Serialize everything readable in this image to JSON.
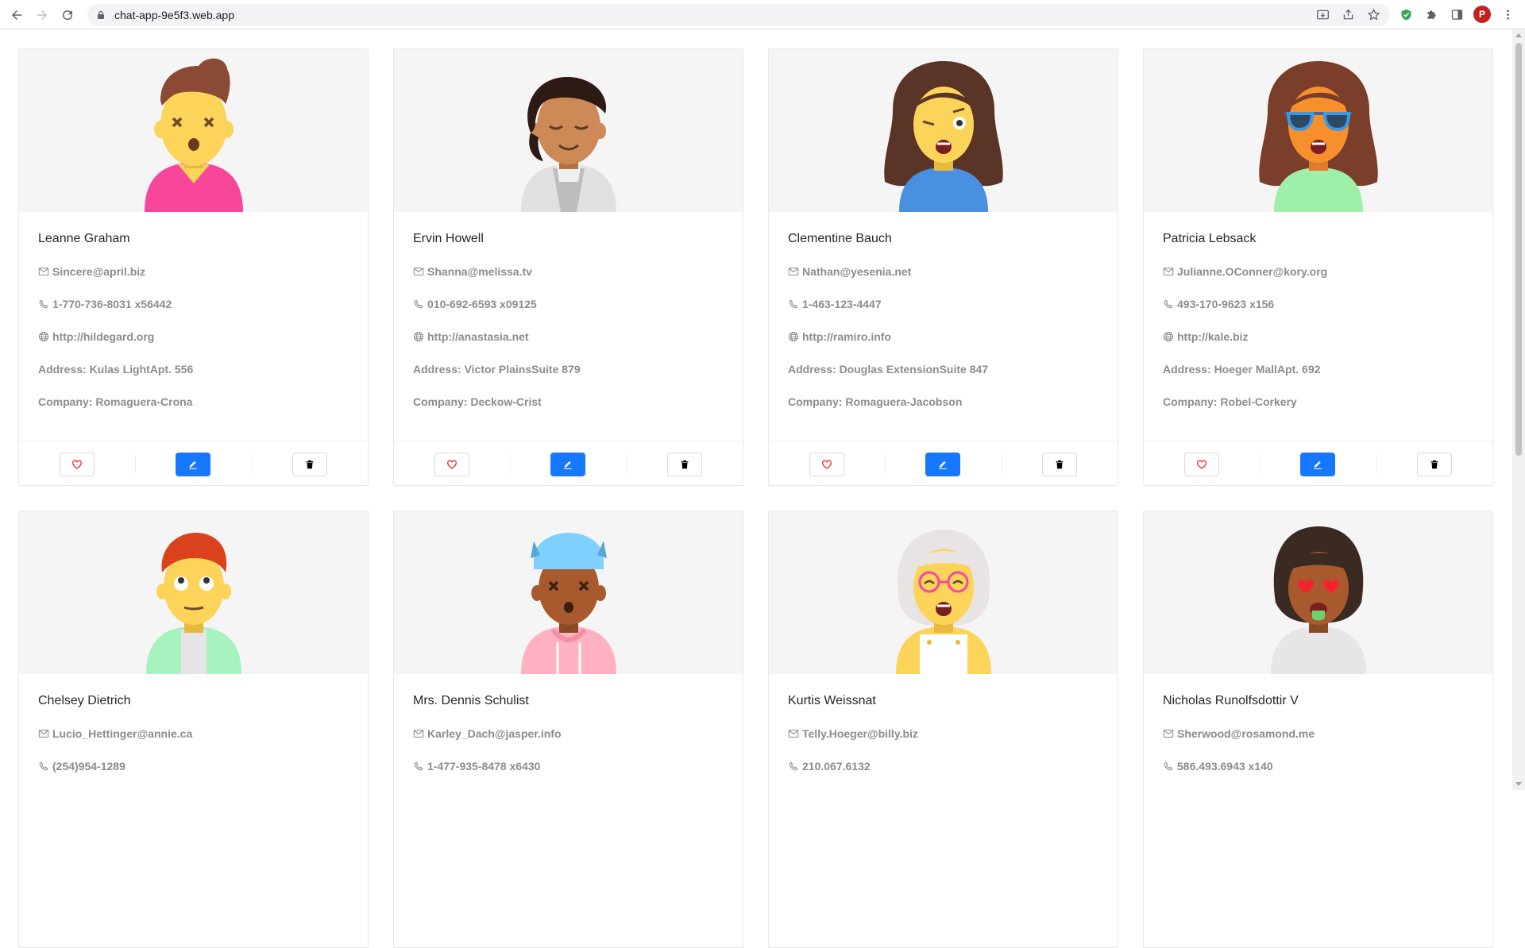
{
  "browser": {
    "url": "chat-app-9e5f3.web.app",
    "profile_initial": "P",
    "icons": [
      "back-icon",
      "forward-icon",
      "reload-icon",
      "lock-icon",
      "install-icon",
      "share-icon",
      "star-icon",
      "shield-extension-icon",
      "puzzle-extension-icon",
      "side-panel-icon",
      "kebab-menu-icon"
    ]
  },
  "colors": {
    "primary": "#1677ff",
    "heart": "#f5222d",
    "cover_bg": "#f5f5f5",
    "muted_text": "#8c8c8c"
  },
  "users": [
    {
      "name": "Leanne Graham",
      "email": "Sincere@april.biz",
      "phone": "1-770-736-8031 x56442",
      "website": "http://hildegard.org",
      "address": "Address: Kulas LightApt. 556",
      "company": "Company: Romaguera-Crona"
    },
    {
      "name": "Ervin Howell",
      "email": "Shanna@melissa.tv",
      "phone": "010-692-6593 x09125",
      "website": "http://anastasia.net",
      "address": "Address: Victor PlainsSuite 879",
      "company": "Company: Deckow-Crist"
    },
    {
      "name": "Clementine Bauch",
      "email": "Nathan@yesenia.net",
      "phone": "1-463-123-4447",
      "website": "http://ramiro.info",
      "address": "Address: Douglas ExtensionSuite 847",
      "company": "Company: Romaguera-Jacobson"
    },
    {
      "name": "Patricia Lebsack",
      "email": "Julianne.OConner@kory.org",
      "phone": "493-170-9623 x156",
      "website": "http://kale.biz",
      "address": "Address: Hoeger MallApt. 692",
      "company": "Company: Robel-Corkery"
    },
    {
      "name": "Chelsey Dietrich",
      "email": "Lucio_Hettinger@annie.ca",
      "phone": "(254)954-1289"
    },
    {
      "name": "Mrs. Dennis Schulist",
      "email": "Karley_Dach@jasper.info",
      "phone": "1-477-935-8478 x6430"
    },
    {
      "name": "Kurtis Weissnat",
      "email": "Telly.Hoeger@billy.biz",
      "phone": "210.067.6132"
    },
    {
      "name": "Nicholas Runolfsdottir V",
      "email": "Sherwood@rosamond.me",
      "phone": "586.493.6943 x140"
    }
  ],
  "card_icons": [
    "mail-icon",
    "phone-icon",
    "globe-icon",
    "heart-icon",
    "edit-icon",
    "delete-icon"
  ]
}
